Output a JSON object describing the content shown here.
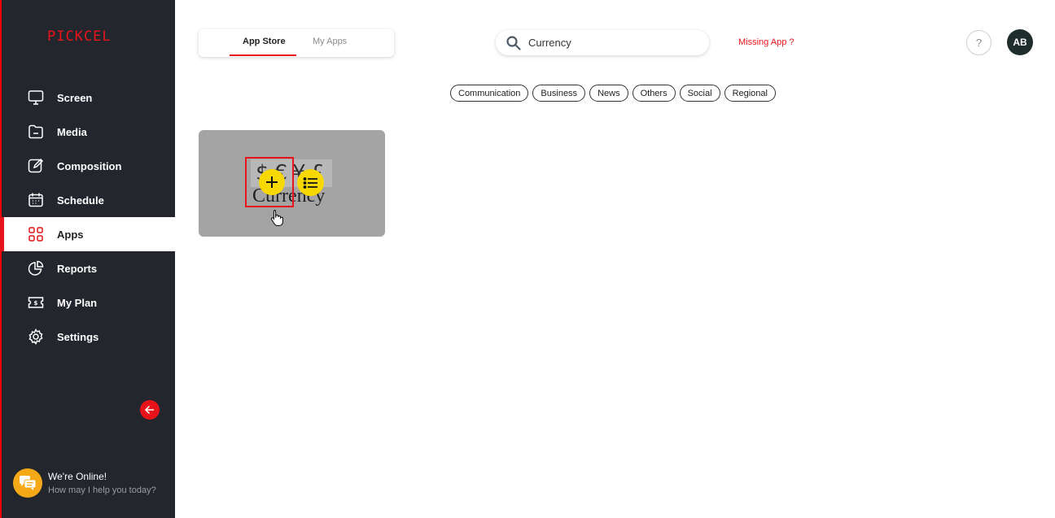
{
  "sidebar": {
    "logo": "PICKCEL",
    "items": [
      {
        "label": "Screen",
        "icon": "monitor-icon"
      },
      {
        "label": "Media",
        "icon": "folder-icon"
      },
      {
        "label": "Composition",
        "icon": "edit-icon"
      },
      {
        "label": "Schedule",
        "icon": "calendar-icon"
      },
      {
        "label": "Apps",
        "icon": "apps-grid-icon",
        "active": true
      },
      {
        "label": "Reports",
        "icon": "pie-chart-icon"
      },
      {
        "label": "My Plan",
        "icon": "ticket-icon"
      },
      {
        "label": "Settings",
        "icon": "gear-icon"
      }
    ],
    "chat": {
      "title": "We're Online!",
      "subtitle": "How may I help you today?"
    }
  },
  "tabs": {
    "store": "App Store",
    "apps": "My Apps"
  },
  "search": {
    "value": "Currency",
    "placeholder": ""
  },
  "missing_app": "Missing App ?",
  "help": "?",
  "avatar": "AB",
  "categories": [
    "Communication",
    "Business",
    "News",
    "Others",
    "Social",
    "Regional"
  ],
  "app_card": {
    "symbols": "$€¥£",
    "name": "Currency"
  },
  "colors": {
    "accent": "#e8141b",
    "sidebar": "#23262d",
    "action": "#f7d800"
  }
}
